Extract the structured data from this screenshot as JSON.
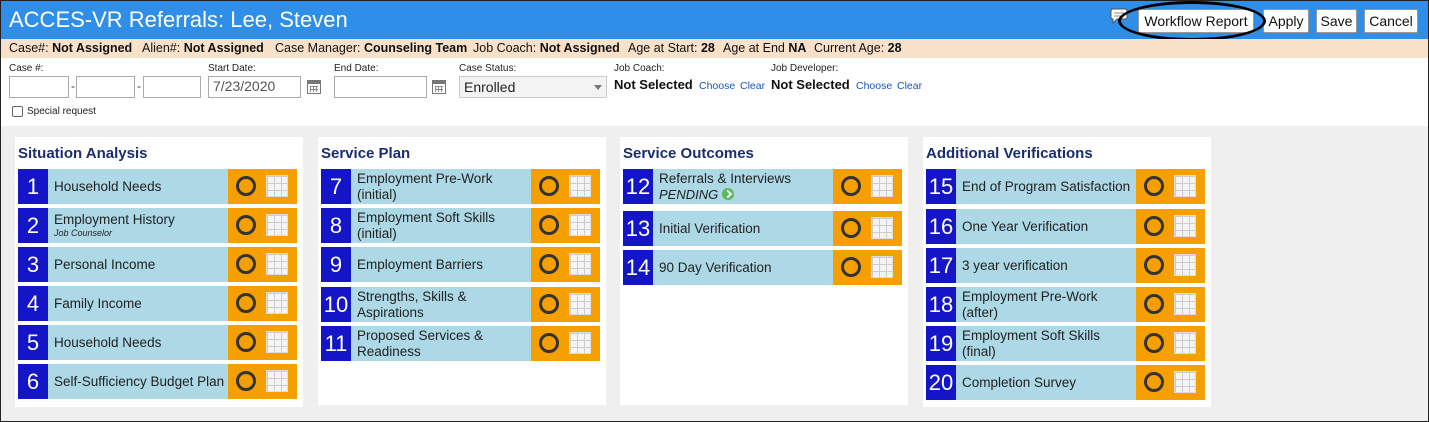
{
  "header": {
    "title": "ACCES-VR Referrals: Lee, Steven",
    "buttons": {
      "workflow_report": "Workflow Report",
      "apply": "Apply",
      "save": "Save",
      "cancel": "Cancel"
    },
    "icons": {
      "chat": "chat-bubble-icon"
    }
  },
  "info": {
    "case_label": "Case#:",
    "case_value": "Not Assigned",
    "alien_label": "Alien#:",
    "alien_value": "Not Assigned",
    "cm_label": "Case Manager:",
    "cm_value": "Counseling Team",
    "jc_label": "Job Coach:",
    "jc_value": "Not Assigned",
    "age_start_label": "Age at Start:",
    "age_start_value": "28",
    "age_end_label": "Age at End",
    "age_end_value": "NA",
    "cur_age_label": "Current Age:",
    "cur_age_value": "28"
  },
  "form": {
    "case_num_label": "Case #:",
    "case_dash": "-",
    "start_date_label": "Start Date:",
    "start_date_value": "7/23/2020",
    "end_date_label": "End Date:",
    "end_date_value": "",
    "case_status_label": "Case Status:",
    "case_status_value": "Enrolled",
    "job_coach_label": "Job Coach:",
    "job_coach_value": "Not Selected",
    "job_dev_label": "Job Developer:",
    "job_dev_value": "Not Selected",
    "choose": "Choose",
    "clear": "Clear",
    "special_request_label": "Special request"
  },
  "panels": [
    {
      "title": "Situation Analysis",
      "items": [
        {
          "num": "1",
          "label": "Household Needs",
          "sub": ""
        },
        {
          "num": "2",
          "label": "Employment History",
          "sub": "Job Counselor"
        },
        {
          "num": "3",
          "label": "Personal Income",
          "sub": ""
        },
        {
          "num": "4",
          "label": "Family Income",
          "sub": ""
        },
        {
          "num": "5",
          "label": "Household Needs",
          "sub": ""
        },
        {
          "num": "6",
          "label": "Self-Sufficiency Budget Plan",
          "sub": ""
        }
      ]
    },
    {
      "title": "Service Plan",
      "items": [
        {
          "num": "7",
          "label": "Employment Pre-Work (initial)"
        },
        {
          "num": "8",
          "label": "Employment Soft Skills (initial)"
        },
        {
          "num": "9",
          "label": "Employment Barriers"
        },
        {
          "num": "10",
          "label": "Strengths, Skills & Aspirations"
        },
        {
          "num": "11",
          "label": "Proposed Services & Readiness"
        }
      ]
    },
    {
      "title": "Service Outcomes",
      "items": [
        {
          "num": "12",
          "label": "Referrals & Interviews",
          "status": "PENDING"
        },
        {
          "num": "13",
          "label": "Initial Verification"
        },
        {
          "num": "14",
          "label": "90 Day Verification"
        }
      ]
    },
    {
      "title": "Additional Verifications",
      "items": [
        {
          "num": "15",
          "label": "End of Program Satisfaction"
        },
        {
          "num": "16",
          "label": "One Year Verification"
        },
        {
          "num": "17",
          "label": "3 year verification"
        },
        {
          "num": "18",
          "label": "Employment Pre-Work (after)"
        },
        {
          "num": "19",
          "label": "Employment Soft Skills (final)"
        },
        {
          "num": "20",
          "label": "Completion Survey"
        }
      ]
    }
  ],
  "colors": {
    "title_bar": "#2f8fe8",
    "info_bar": "#f8e1c8",
    "step_number": "#1515c8",
    "step_label": "#add8e6",
    "step_actions": "#f5a000",
    "panel_title": "#1a2d6e"
  }
}
